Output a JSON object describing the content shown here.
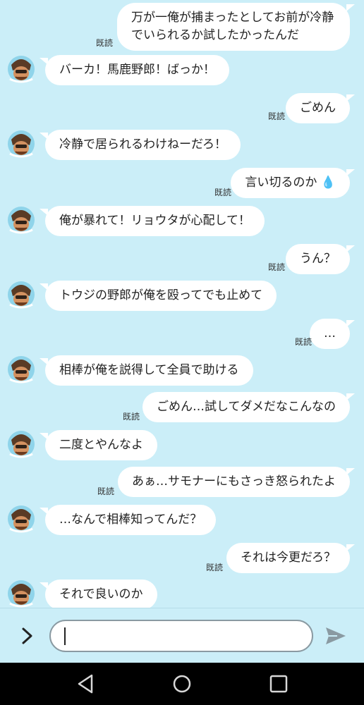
{
  "messages": [
    {
      "side": "right",
      "lines": [
        "万が一俺が捕まったとしてお前が冷静",
        "でいられるか試したかったんだ"
      ],
      "read": "既読"
    },
    {
      "side": "left",
      "lines": [
        "バーカ！馬鹿野郎！ばっか！"
      ]
    },
    {
      "side": "right",
      "lines": [
        "ごめん"
      ],
      "read": "既読"
    },
    {
      "side": "left",
      "lines": [
        "冷静で居られるわけねーだろ！"
      ]
    },
    {
      "side": "right",
      "lines": [
        "言い切るのか 💧"
      ],
      "read": "既読"
    },
    {
      "side": "left",
      "lines": [
        "俺が暴れて！リョウタが心配して！"
      ]
    },
    {
      "side": "right",
      "lines": [
        "うん？"
      ],
      "read": "既読"
    },
    {
      "side": "left",
      "lines": [
        "トウジの野郎が俺を殴ってでも止めて"
      ]
    },
    {
      "side": "right",
      "lines": [
        "…"
      ],
      "read": "既読"
    },
    {
      "side": "left",
      "lines": [
        "相棒が俺を説得して全員で助ける"
      ]
    },
    {
      "side": "right",
      "lines": [
        "ごめん…試してダメだなこんなの"
      ],
      "read": "既読"
    },
    {
      "side": "left",
      "lines": [
        "二度とやんなよ"
      ]
    },
    {
      "side": "right",
      "lines": [
        "あぁ…サモナーにもさっき怒られたよ"
      ],
      "read": "既読"
    },
    {
      "side": "left",
      "lines": [
        "…なんで相棒知ってんだ？"
      ]
    },
    {
      "side": "right",
      "lines": [
        "それは今更だろ？"
      ],
      "read": "既読"
    },
    {
      "side": "left",
      "lines": [
        "それで良いのか"
      ]
    }
  ],
  "input": {
    "value": ""
  },
  "icons": {
    "expand": "chevron-right-icon",
    "send": "send-icon",
    "back": "nav-back-icon",
    "home": "nav-home-icon",
    "recents": "nav-recents-icon"
  },
  "colors": {
    "background": "#cbeef8",
    "bubble": "#ffffff",
    "navbar": "#000000",
    "send_icon": "#8a9aa2"
  }
}
